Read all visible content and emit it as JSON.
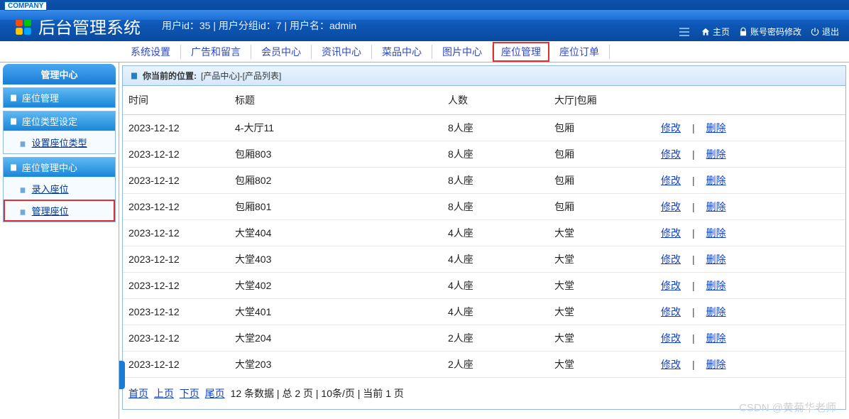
{
  "company_tag": "COMPANY",
  "header": {
    "title": "后台管理系统",
    "userinfo": "用户id：35 | 用户分组id：7 | 用户名：admin",
    "btn_home": "主页",
    "btn_pwd": "账号密码修改",
    "btn_logout": "退出"
  },
  "nav": {
    "items": [
      "系统设置",
      "广告和留言",
      "会员中心",
      "资讯中心",
      "菜品中心",
      "图片中心",
      "座位管理",
      "座位订单"
    ]
  },
  "sidebar": {
    "tab": "管理中心",
    "box1": {
      "title": "座位管理",
      "items": []
    },
    "box2": {
      "title": "座位类型设定",
      "items": [
        "设置座位类型"
      ]
    },
    "box3": {
      "title": "座位管理中心",
      "items": [
        "录入座位",
        "管理座位"
      ]
    }
  },
  "breadcrumb": {
    "label": "你当前的位置:",
    "path": "[产品中心]-[产品列表]"
  },
  "table": {
    "headers": [
      "时间",
      "标题",
      "人数",
      "大厅|包厢",
      ""
    ],
    "rows": [
      {
        "date": "2023-12-12",
        "title": "4-大厅11",
        "people": "8人座",
        "area": "包厢"
      },
      {
        "date": "2023-12-12",
        "title": "包厢803",
        "people": "8人座",
        "area": "包厢"
      },
      {
        "date": "2023-12-12",
        "title": "包厢802",
        "people": "8人座",
        "area": "包厢"
      },
      {
        "date": "2023-12-12",
        "title": "包厢801",
        "people": "8人座",
        "area": "包厢"
      },
      {
        "date": "2023-12-12",
        "title": "大堂404",
        "people": "4人座",
        "area": "大堂"
      },
      {
        "date": "2023-12-12",
        "title": "大堂403",
        "people": "4人座",
        "area": "大堂"
      },
      {
        "date": "2023-12-12",
        "title": "大堂402",
        "people": "4人座",
        "area": "大堂"
      },
      {
        "date": "2023-12-12",
        "title": "大堂401",
        "people": "4人座",
        "area": "大堂"
      },
      {
        "date": "2023-12-12",
        "title": "大堂204",
        "people": "2人座",
        "area": "大堂"
      },
      {
        "date": "2023-12-12",
        "title": "大堂203",
        "people": "2人座",
        "area": "大堂"
      }
    ],
    "edit": "修改",
    "delete": "删除"
  },
  "pagination": {
    "first": "首页",
    "prev": "上页",
    "next": "下页",
    "last": "尾页",
    "info": "12 条数据 | 总 2 页 | 10条/页 | 当前 1 页"
  },
  "watermark": "CSDN @黄菊华老师"
}
